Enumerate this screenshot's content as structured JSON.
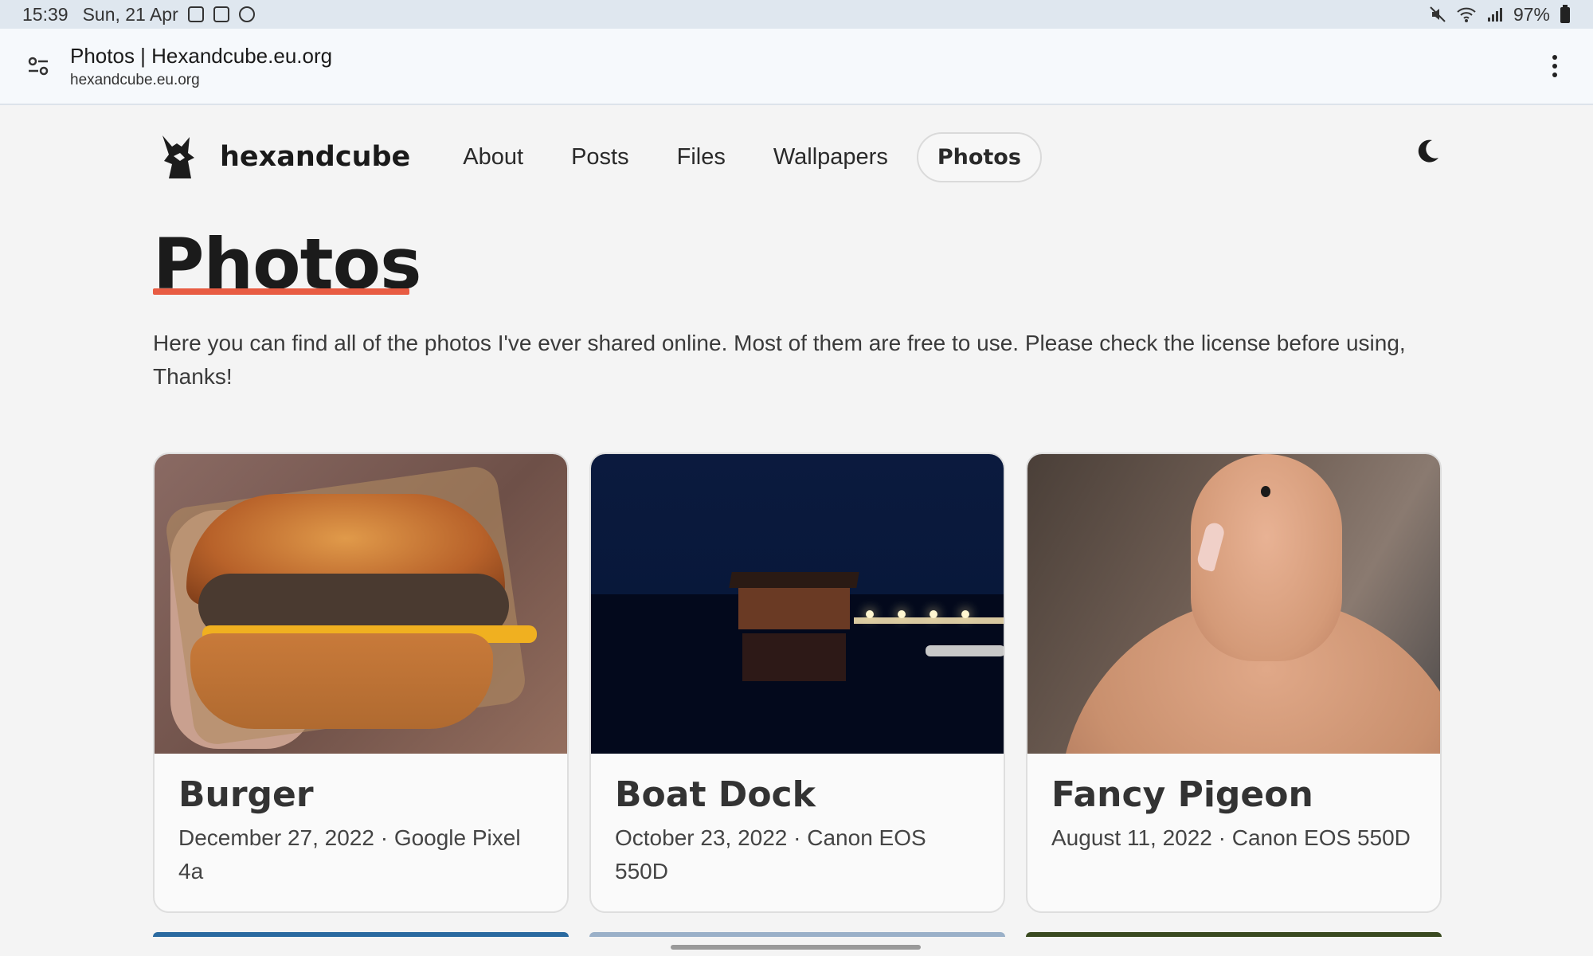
{
  "status_bar": {
    "time": "15:39",
    "date": "Sun, 21 Apr",
    "battery": "97%",
    "icons_left": [
      "gallery-icon",
      "screenshot-icon",
      "dnd-icon"
    ],
    "icons_right": [
      "mute-icon",
      "wifi-icon",
      "signal-icon",
      "battery-icon"
    ]
  },
  "browser": {
    "page_title": "Photos | Hexandcube.eu.org",
    "domain": "hexandcube.eu.org"
  },
  "site": {
    "brand": "hexandcube",
    "nav": [
      "About",
      "Posts",
      "Files",
      "Wallpapers",
      "Photos"
    ],
    "active_nav": "Photos"
  },
  "page": {
    "title": "Photos",
    "intro": "Here you can find all of the photos I've ever shared online. Most of them are free to use. Please check the license before using, Thanks!"
  },
  "photos": [
    {
      "title": "Burger",
      "meta": "December 27, 2022 · Google Pixel 4a"
    },
    {
      "title": "Boat Dock",
      "meta": "October 23, 2022 · Canon EOS 550D"
    },
    {
      "title": "Fancy Pigeon",
      "meta": "August 11, 2022 · Canon EOS 550D"
    }
  ],
  "colors": {
    "accent_underline": "#e85c43",
    "page_bg": "#f4f4f4"
  }
}
